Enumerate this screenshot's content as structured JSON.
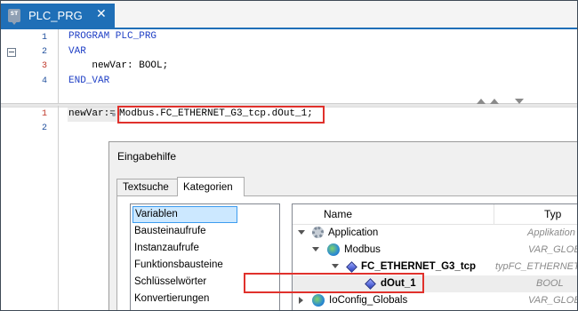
{
  "editor_tab": {
    "icon": "st-file-icon",
    "icon_text": "ST",
    "label": "PLC_PRG",
    "close": "✕"
  },
  "declaration": {
    "lines": [
      {
        "number": "1",
        "text": "PROGRAM PLC_PRG",
        "keyword": true
      },
      {
        "number": "2",
        "text": "VAR",
        "keyword": true
      },
      {
        "number": "3",
        "text": "    newVar: BOOL;",
        "keyword": false
      },
      {
        "number": "4",
        "text": "END_VAR",
        "keyword": true
      }
    ]
  },
  "implementation": {
    "lines": [
      {
        "number": "1",
        "lhs": "newVar:=",
        "rhs": "Modbus.FC_ETHERNET_G3_tcp.dOut_1;"
      },
      {
        "number": "2"
      }
    ]
  },
  "dialog": {
    "title": "Eingabehilfe",
    "tabs": [
      {
        "label": "Textsuche"
      },
      {
        "label": "Kategorien",
        "active": true
      }
    ],
    "categories": [
      {
        "label": "Variablen",
        "selected": true
      },
      {
        "label": "Bausteinaufrufe"
      },
      {
        "label": "Instanzaufrufe"
      },
      {
        "label": "Funktionsbausteine"
      },
      {
        "label": "Schlüsselwörter"
      },
      {
        "label": "Konvertierungen"
      }
    ],
    "tree": {
      "columns": {
        "name": "Name",
        "type": "Typ"
      },
      "rows": [
        {
          "name": "Application",
          "type": "Applikation",
          "icon": "application-gear-icon",
          "expanded": true
        },
        {
          "name": "Modbus",
          "type": "VAR_GLOBAL",
          "icon": "global-vars-icon",
          "expanded": true
        },
        {
          "name": "FC_ETHERNET_G3_tcp",
          "type": "typFC_ETHERNET_G",
          "icon": "instance-icon",
          "expanded": true
        },
        {
          "name": "dOut_1",
          "type": "BOOL",
          "icon": "variable-icon",
          "highlighted": true
        },
        {
          "name": "IoConfig_Globals",
          "type": "VAR_GLOBAL",
          "icon": "global-vars-icon",
          "expanded": false
        }
      ]
    }
  },
  "colors": {
    "tab_active": "#1f6fb7",
    "keyword": "#1f3fc5",
    "highlight_box": "#e0312c",
    "line_number": "#1f4e9c"
  }
}
